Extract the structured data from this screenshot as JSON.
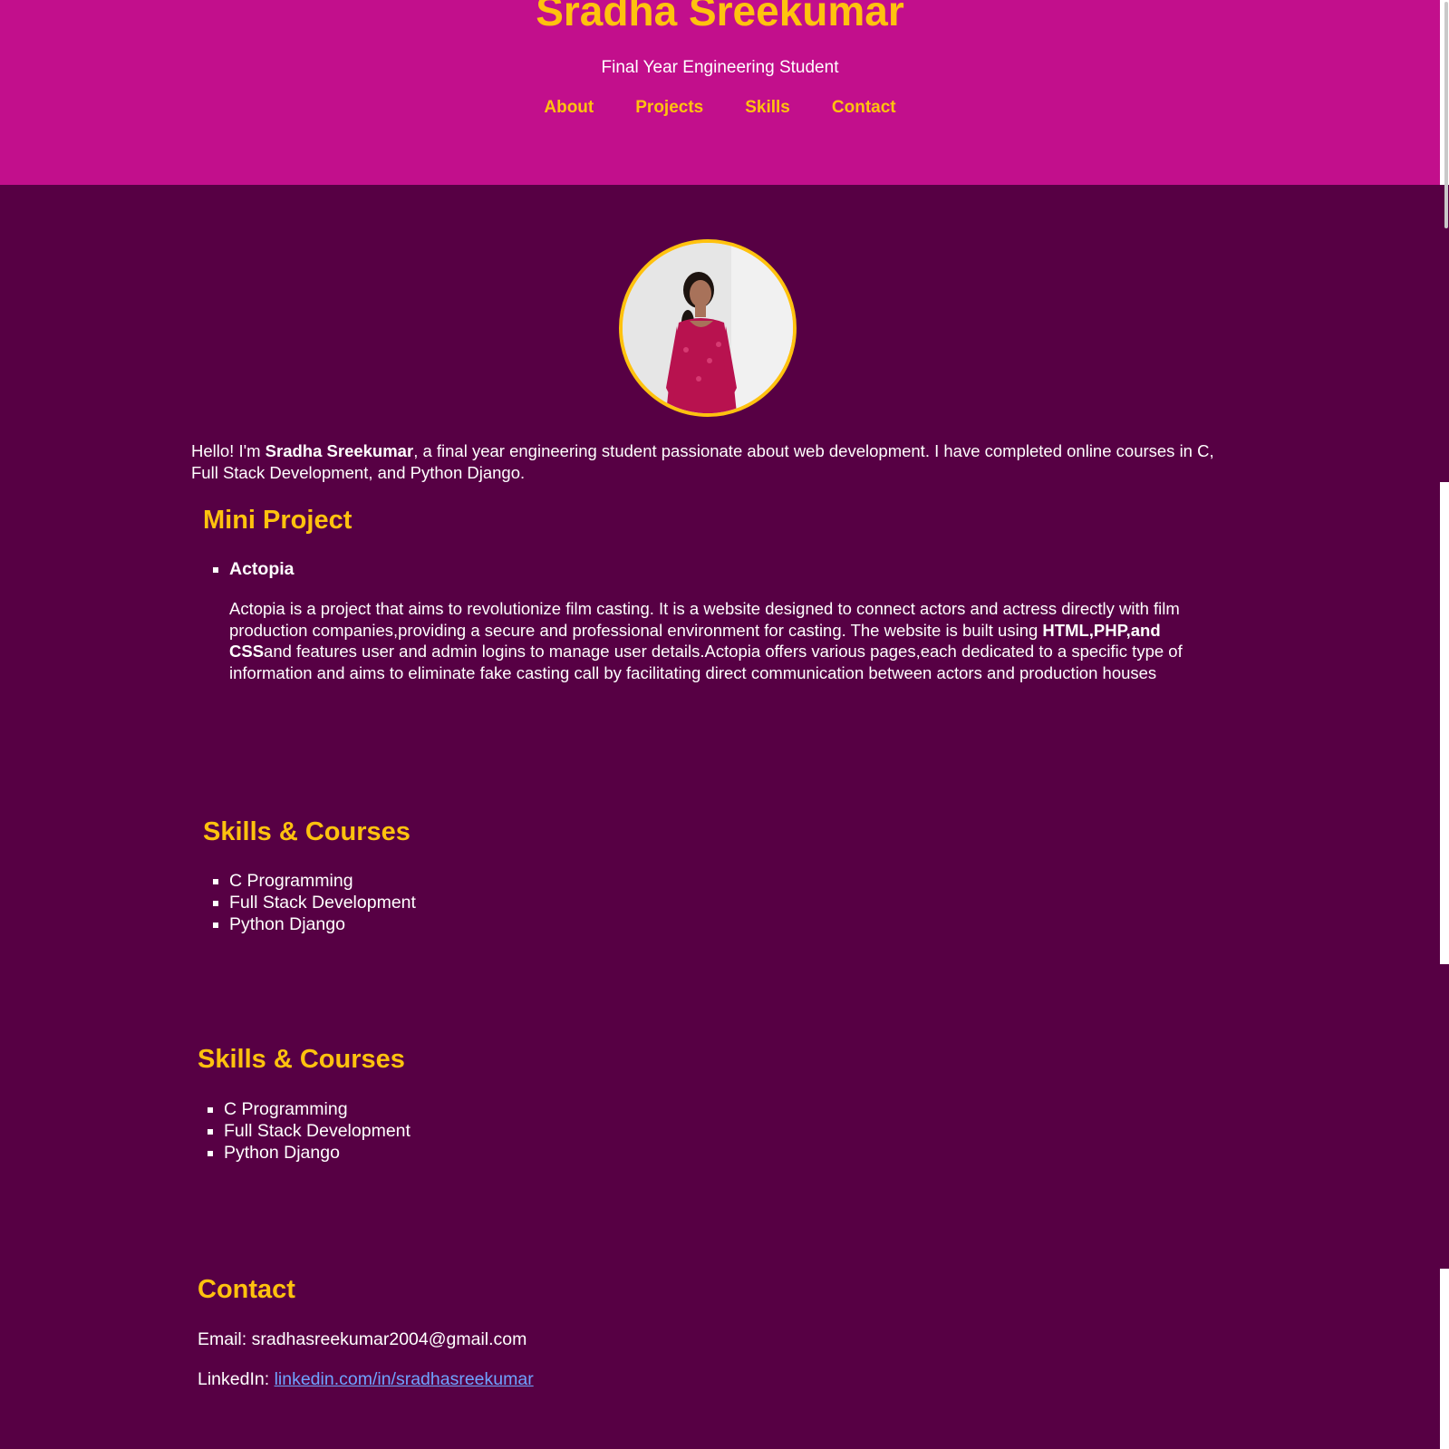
{
  "header": {
    "title": "Sradha Sreekumar",
    "subtitle": "Final Year Engineering Student",
    "nav": [
      "About",
      "Projects",
      "Skills",
      "Contact"
    ]
  },
  "about": {
    "intro_prefix": "Hello! I'm ",
    "name": "Sradha Sreekumar",
    "intro_rest": ", a final year engineering student passionate about web development. I have completed online courses in C, Full Stack Development, and Python Django."
  },
  "projects": {
    "title": "Mini Project",
    "items": [
      {
        "name": "Actopia",
        "desc_part1": "Actopia is a project that aims to revolutionize film casting. It is a website designed to connect actors and actress directly with film production companies,providing a secure and professional environment for casting. The website is built using ",
        "desc_bold": "HTML,PHP,and CSS",
        "desc_part2": "and features user and admin logins to manage user details.Actopia offers various pages,each dedicated to a specific type of information and aims to eliminate fake casting call by facilitating direct communication between actors and production houses"
      }
    ]
  },
  "skills_1": {
    "title": "Skills & Courses",
    "items": [
      "C Programming",
      "Full Stack Development",
      "Python Django"
    ]
  },
  "skills_2": {
    "title": "Skills & Courses",
    "items": [
      "C Programming",
      "Full Stack Development",
      "Python Django"
    ]
  },
  "contact": {
    "title": "Contact",
    "email_label": "Email: ",
    "email": "sradhasreekumar2004@gmail.com",
    "linkedin_label": "LinkedIn: ",
    "linkedin": "linkedin.com/in/sradhasreekumar"
  },
  "colors": {
    "header_bg": "#c20f8c",
    "body_bg": "#570044",
    "accent": "#ffc20e",
    "link": "#6fa3ff"
  }
}
